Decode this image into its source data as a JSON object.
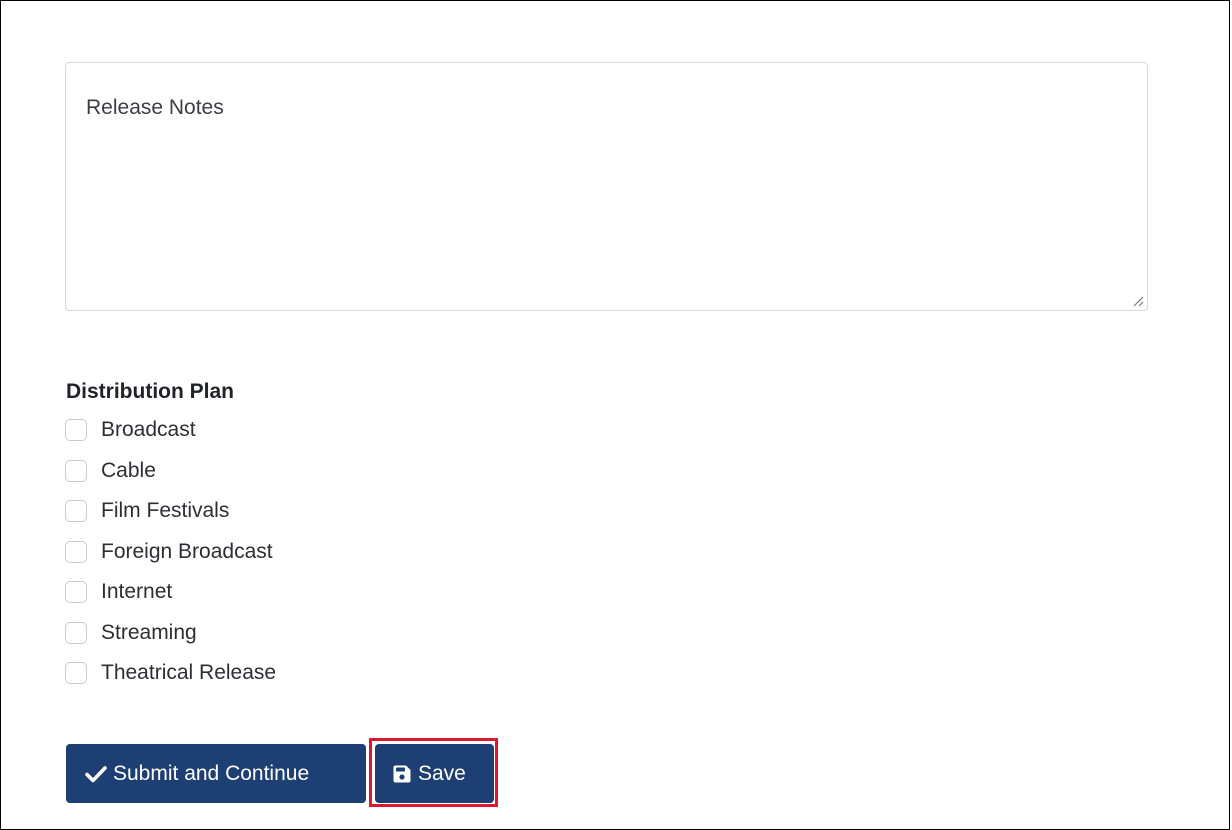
{
  "release_notes": {
    "placeholder": "Release Notes"
  },
  "distribution_plan": {
    "heading": "Distribution Plan",
    "options": [
      {
        "label": "Broadcast",
        "checked": false
      },
      {
        "label": "Cable",
        "checked": false
      },
      {
        "label": "Film Festivals",
        "checked": false
      },
      {
        "label": "Foreign Broadcast",
        "checked": false
      },
      {
        "label": "Internet",
        "checked": false
      },
      {
        "label": "Streaming",
        "checked": false
      },
      {
        "label": "Theatrical Release",
        "checked": false
      }
    ]
  },
  "actions": {
    "submit_label": "Submit and Continue",
    "submit_icon": "checkmark-icon",
    "save_label": "Save",
    "save_icon": "floppy-disk-icon",
    "highlighted": "save"
  },
  "colors": {
    "button_bg": "#1e3f73",
    "button_text": "#ffffff",
    "highlight": "#e0182d"
  }
}
